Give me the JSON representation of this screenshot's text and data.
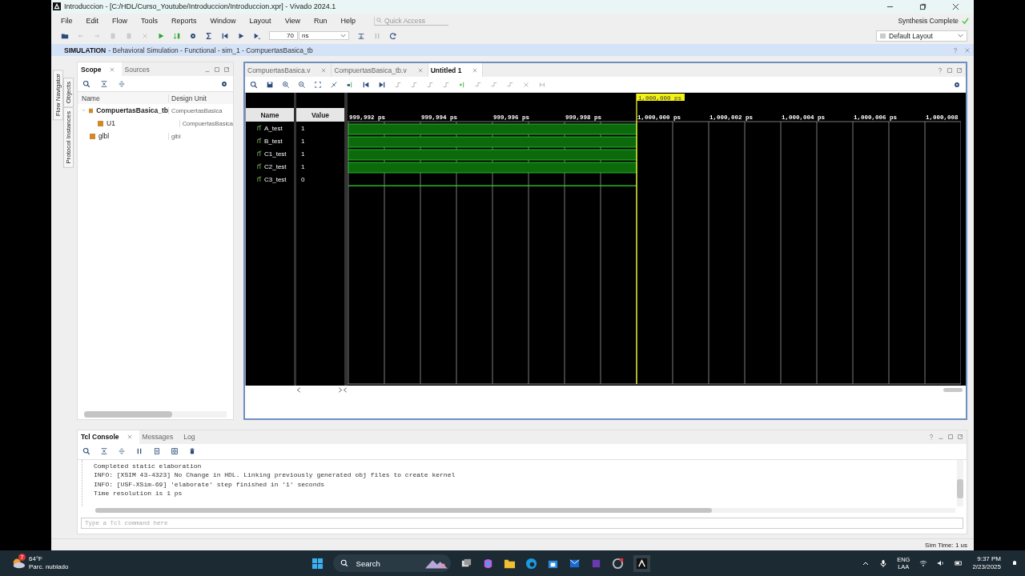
{
  "window": {
    "title": "Introduccion - [C:/HDL/Curso_Youtube/Introduccion/Introduccion.xpr] - Vivado 2024.1"
  },
  "menu": [
    "File",
    "Edit",
    "Flow",
    "Tools",
    "Reports",
    "Window",
    "Layout",
    "View",
    "Run",
    "Help"
  ],
  "quick_access": {
    "placeholder": "Quick Access"
  },
  "status": "Synthesis Complete",
  "toolbar": {
    "time_value": "70",
    "time_unit": "ns",
    "layout": "Default Layout"
  },
  "sim_header": {
    "title": "SIMULATION",
    "subtitle": "- Behavioral Simulation - Functional - sim_1 - CompuertasBasica_tb"
  },
  "side_tabs": [
    "Flow Navigator",
    "Objects",
    "Protocol Instances"
  ],
  "scope": {
    "tabs": [
      {
        "label": "Scope",
        "selected": true
      },
      {
        "label": "Sources",
        "selected": false
      }
    ],
    "columns": [
      "Name",
      "Design Unit"
    ],
    "tree": [
      {
        "name": "CompuertasBasica_tb",
        "unit": "CompuertasBasica",
        "selected": true,
        "expanded": true,
        "children": [
          {
            "name": "U1",
            "unit": "CompuertasBasica",
            "selected": false
          }
        ]
      },
      {
        "name": "glbl",
        "unit": "glbl",
        "selected": false
      }
    ]
  },
  "editor_tabs": [
    {
      "label": "CompuertasBasica.v",
      "selected": false
    },
    {
      "label": "CompuertasBasica_tb.v",
      "selected": false
    },
    {
      "label": "Untitled 1",
      "selected": true
    }
  ],
  "wave": {
    "columns": [
      "Name",
      "Value"
    ],
    "cursor": "1,000,000 ps",
    "ticks": [
      "999,992 ps",
      "999,994 ps",
      "999,996 ps",
      "999,998 ps",
      "1,000,000 ps",
      "1,000,002 ps",
      "1,000,004 ps",
      "1,000,006 ps",
      "1,000,008"
    ],
    "signals": [
      {
        "name": "A_test",
        "value": "1",
        "high": true
      },
      {
        "name": "B_test",
        "value": "1",
        "high": true
      },
      {
        "name": "C1_test",
        "value": "1",
        "high": true
      },
      {
        "name": "C2_test",
        "value": "1",
        "high": true
      },
      {
        "name": "C3_test",
        "value": "0",
        "high": false
      }
    ]
  },
  "console": {
    "tabs": [
      {
        "label": "Tcl Console",
        "selected": true
      },
      {
        "label": "Messages",
        "selected": false
      },
      {
        "label": "Log",
        "selected": false
      }
    ],
    "lines": [
      "Completed static elaboration",
      "INFO: [XSIM 43-4323] No Change in HDL. Linking previously generated obj files to create kernel",
      "INFO: [USF-XSim-69] 'elaborate' step finished in '1' seconds",
      "Time resolution is 1 ps"
    ],
    "placeholder": "Type a Tcl command here"
  },
  "status_bar": "Sim Time: 1 us",
  "taskbar": {
    "weather_badge": "7",
    "temperature": "64°F",
    "weather": "Parc. nublado",
    "search": "Search",
    "lang": "ENG",
    "region": "LAA",
    "time": "9:37 PM",
    "date": "2/23/2025"
  }
}
